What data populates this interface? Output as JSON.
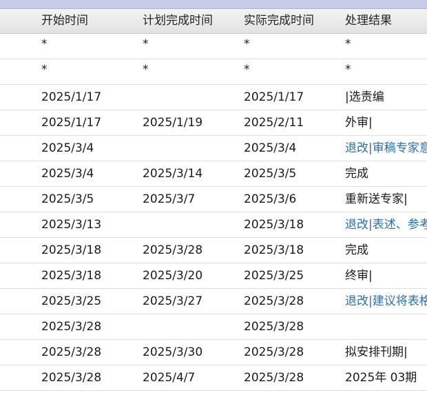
{
  "columns": [
    "开始时间",
    "计划完成时间",
    "实际完成时间",
    "处理结果"
  ],
  "colors": {
    "link": "#2e6ea3",
    "header_bg": "#e8e8e8",
    "topbar": "#c7cce9"
  },
  "rows": [
    {
      "start": "*",
      "plan": "*",
      "actual": "*",
      "result": "*",
      "link": false
    },
    {
      "start": "*",
      "plan": "*",
      "actual": "*",
      "result": "*",
      "link": false
    },
    {
      "start": "2025/1/17",
      "plan": "",
      "actual": "2025/1/17",
      "result": "|选责编",
      "link": false
    },
    {
      "start": "2025/1/17",
      "plan": "2025/1/19",
      "actual": "2025/2/11",
      "result": "外审|",
      "link": false
    },
    {
      "start": "2025/3/4",
      "plan": "",
      "actual": "2025/3/4",
      "result": "退改|审稿专家意",
      "link": true
    },
    {
      "start": "2025/3/4",
      "plan": "2025/3/14",
      "actual": "2025/3/5",
      "result": "完成",
      "link": false
    },
    {
      "start": "2025/3/5",
      "plan": "2025/3/7",
      "actual": "2025/3/6",
      "result": "重新送专家|",
      "link": false
    },
    {
      "start": "2025/3/13",
      "plan": "",
      "actual": "2025/3/18",
      "result": "退改|表述、参考",
      "link": true
    },
    {
      "start": "2025/3/18",
      "plan": "2025/3/28",
      "actual": "2025/3/18",
      "result": "完成",
      "link": false
    },
    {
      "start": "2025/3/18",
      "plan": "2025/3/20",
      "actual": "2025/3/25",
      "result": "终审|",
      "link": false
    },
    {
      "start": "2025/3/25",
      "plan": "2025/3/27",
      "actual": "2025/3/28",
      "result": "退改|建议将表格",
      "link": true
    },
    {
      "start": "2025/3/28",
      "plan": "",
      "actual": "2025/3/28",
      "result": "",
      "link": false
    },
    {
      "start": "2025/3/28",
      "plan": "2025/3/30",
      "actual": "2025/3/28",
      "result": "拟安排刊期|",
      "link": false
    },
    {
      "start": "2025/3/28",
      "plan": "2025/4/7",
      "actual": "2025/3/28",
      "result": "2025年 03期",
      "link": false
    }
  ]
}
